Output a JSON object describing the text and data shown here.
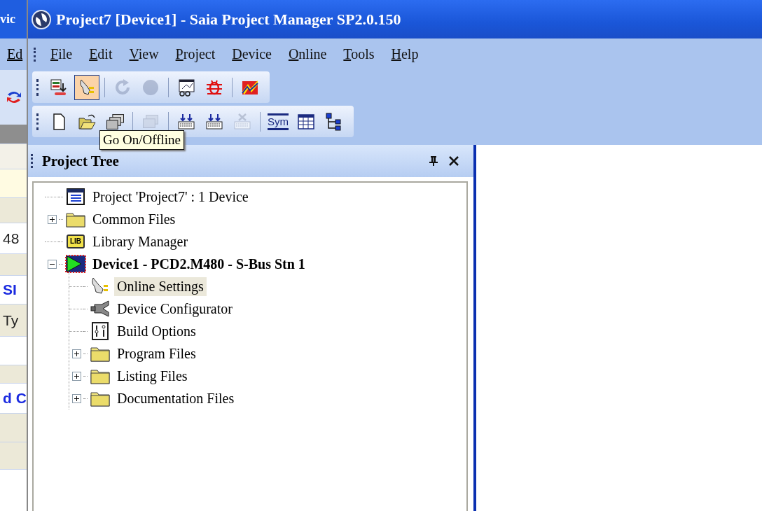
{
  "background_window": {
    "title_fragment": "vic",
    "menu_fragment": "Ed",
    "fragments": [
      {
        "text": "48",
        "kind": "plain"
      },
      {
        "text": "SI",
        "kind": "heading"
      },
      {
        "text": "Ty",
        "kind": "plain"
      },
      {
        "text": "d C",
        "kind": "heading"
      }
    ]
  },
  "window": {
    "title": "Project7 [Device1] - Saia Project Manager SP2.0.150"
  },
  "menu": [
    "File",
    "Edit",
    "View",
    "Project",
    "Device",
    "Online",
    "Tools",
    "Help"
  ],
  "toolbars": [
    {
      "buttons": [
        {
          "kind": "button",
          "pressed": false,
          "disabled": false
        },
        {
          "kind": "button",
          "pressed": true,
          "disabled": false
        },
        {
          "kind": "separator"
        },
        {
          "kind": "button",
          "pressed": false,
          "disabled": true
        },
        {
          "kind": "button",
          "pressed": false,
          "disabled": true
        },
        {
          "kind": "separator"
        },
        {
          "kind": "button",
          "pressed": false,
          "disabled": false
        },
        {
          "kind": "button",
          "pressed": false,
          "disabled": false
        },
        {
          "kind": "separator"
        },
        {
          "kind": "button",
          "pressed": false,
          "disabled": false
        }
      ]
    },
    {
      "buttons": [
        {
          "kind": "button",
          "pressed": false,
          "disabled": false
        },
        {
          "kind": "button",
          "pressed": false,
          "disabled": false
        },
        {
          "kind": "button",
          "pressed": false,
          "disabled": false
        },
        {
          "kind": "separator"
        },
        {
          "kind": "button",
          "pressed": false,
          "disabled": true
        },
        {
          "kind": "separator"
        },
        {
          "kind": "button",
          "pressed": false,
          "disabled": false
        },
        {
          "kind": "button",
          "pressed": false,
          "disabled": false
        },
        {
          "kind": "button",
          "pressed": false,
          "disabled": true
        },
        {
          "kind": "separator"
        },
        {
          "kind": "button",
          "pressed": false,
          "disabled": false,
          "label": "Sym"
        },
        {
          "kind": "button",
          "pressed": false,
          "disabled": false
        },
        {
          "kind": "button",
          "pressed": false,
          "disabled": false
        }
      ]
    }
  ],
  "tooltip": "Go On/Offline",
  "project_tree": {
    "title": "Project Tree",
    "items": [
      {
        "label": "Project 'Project7' : 1 Device",
        "kind": "project",
        "selected": false,
        "active": false
      },
      {
        "label": "Common Files",
        "kind": "folder",
        "expanded": false,
        "selected": false,
        "active": false
      },
      {
        "label": "Library Manager",
        "kind": "library",
        "icon_text": "LIB",
        "selected": false,
        "active": false
      },
      {
        "label": "Device1 - PCD2.M480 - S-Bus Stn 1",
        "kind": "device",
        "expanded": true,
        "selected": false,
        "active": true,
        "children": [
          {
            "label": "Online Settings",
            "kind": "online",
            "selected": true,
            "active": false
          },
          {
            "label": "Device Configurator",
            "kind": "config",
            "selected": false,
            "active": false
          },
          {
            "label": "Build Options",
            "kind": "build",
            "selected": false,
            "active": false
          },
          {
            "label": "Program Files",
            "kind": "folder",
            "expanded": false,
            "selected": false,
            "active": false
          },
          {
            "label": "Listing Files",
            "kind": "folder",
            "expanded": false,
            "selected": false,
            "active": false
          },
          {
            "label": "Documentation Files",
            "kind": "folder",
            "expanded": false,
            "selected": false,
            "active": false
          }
        ]
      }
    ]
  }
}
